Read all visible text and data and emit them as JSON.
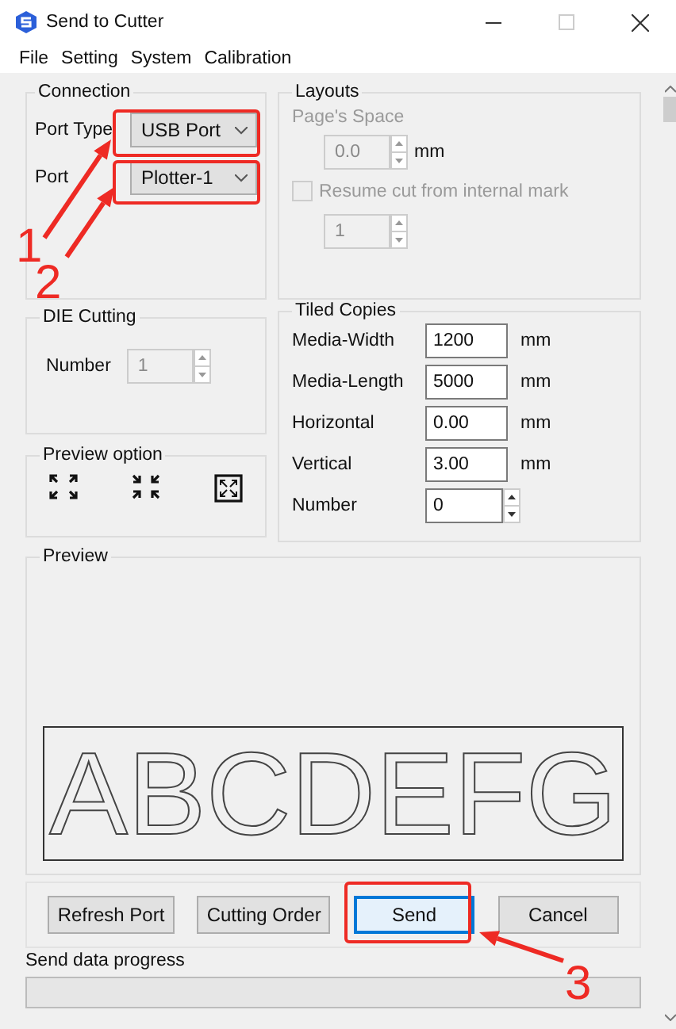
{
  "window": {
    "title": "Send to Cutter"
  },
  "menu": [
    "File",
    "Setting",
    "System",
    "Calibration"
  ],
  "connection": {
    "title": "Connection",
    "port_type": {
      "label": "Port Type",
      "value": "USB Port"
    },
    "port": {
      "label": "Port",
      "value": "Plotter-1"
    }
  },
  "layouts": {
    "title": "Layouts",
    "pages_space": {
      "label": "Page's Space",
      "value": "0.0",
      "unit": "mm",
      "disabled": true
    },
    "resume": {
      "label": "Resume cut from internal mark",
      "checked": false,
      "disabled": true
    },
    "mark_number": {
      "value": "1",
      "disabled": true
    }
  },
  "die_cutting": {
    "title": "DIE Cutting",
    "number": {
      "label": "Number",
      "value": "1",
      "disabled": true
    }
  },
  "preview_option": {
    "title": "Preview option"
  },
  "tiled_copies": {
    "title": "Tiled Copies",
    "fields": [
      {
        "label": "Media-Width",
        "value": "1200",
        "unit": "mm",
        "kind": "text"
      },
      {
        "label": "Media-Length",
        "value": "5000",
        "unit": "mm",
        "kind": "text"
      },
      {
        "label": "Horizontal",
        "value": "0.00",
        "unit": "mm",
        "kind": "text"
      },
      {
        "label": "Vertical",
        "value": "3.00",
        "unit": "mm",
        "kind": "text"
      },
      {
        "label": "Number",
        "value": "0",
        "kind": "spinner"
      }
    ]
  },
  "preview": {
    "title": "Preview",
    "sample_text": "ABCDEFG"
  },
  "buttons": [
    {
      "label": "Refresh Port",
      "focused": false
    },
    {
      "label": "Cutting Order",
      "focused": false
    },
    {
      "label": "Send",
      "focused": true
    },
    {
      "label": "Cancel",
      "focused": false
    }
  ],
  "progress": {
    "label": "Send data progress",
    "level": 0
  },
  "annotations": [
    "1",
    "2",
    "3"
  ]
}
